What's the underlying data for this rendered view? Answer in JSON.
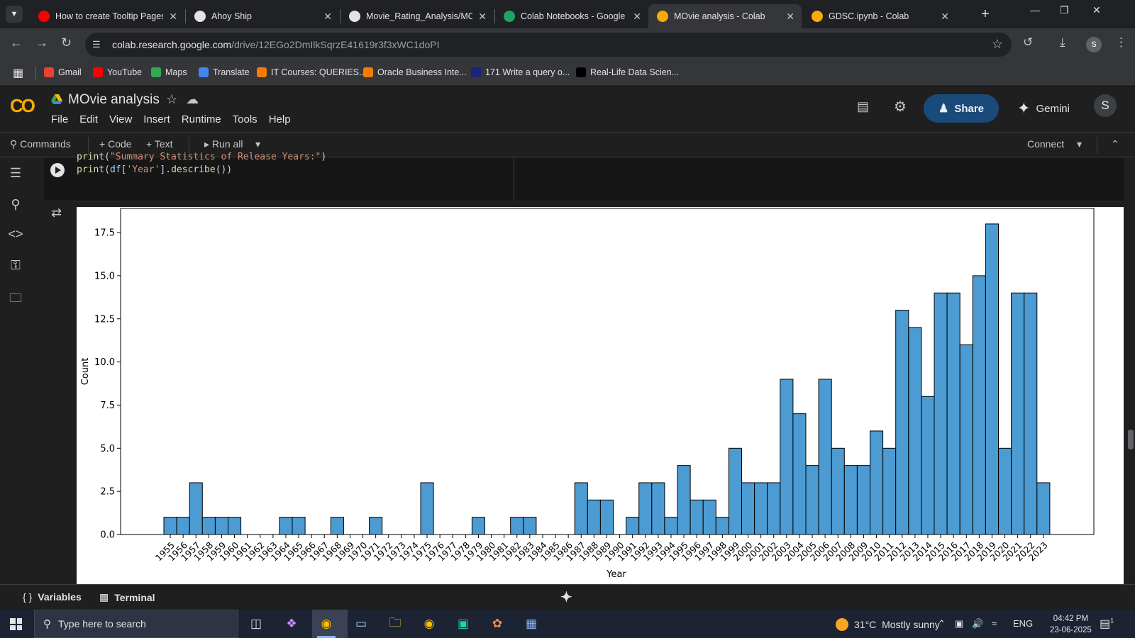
{
  "browser": {
    "tabs": [
      {
        "title": "How to create Tooltip Pages",
        "favicon": "youtube-icon",
        "color": "#ff0000"
      },
      {
        "title": "Ahoy Ship",
        "favicon": "chatgpt-icon",
        "color": "#e3e3e3"
      },
      {
        "title": "Movie_Rating_Analysis/MOvi",
        "favicon": "github-icon",
        "color": "#e3e3e3"
      },
      {
        "title": "Colab Notebooks - Google D",
        "favicon": "google-drive-icon",
        "color": "#1fa463"
      },
      {
        "title": "MOvie analysis - Colab",
        "favicon": "colab-icon",
        "color": "#f9ab00",
        "active": true
      },
      {
        "title": "GDSC.ipynb - Colab",
        "favicon": "colab-icon",
        "color": "#f9ab00"
      }
    ],
    "url_host": "colab.research.google.com",
    "url_path": "/drive/12EGo2DmIlkSqrzE41619r3f3xWC1doPI",
    "profile_initial": "S",
    "bookmarks": [
      {
        "label": "Gmail",
        "icon": "gmail-icon",
        "color": "#ea4335"
      },
      {
        "label": "YouTube",
        "icon": "youtube-icon",
        "color": "#ff0000"
      },
      {
        "label": "Maps",
        "icon": "maps-icon",
        "color": "#34a853"
      },
      {
        "label": "Translate",
        "icon": "translate-icon",
        "color": "#4285f4"
      },
      {
        "label": "IT Courses: QUERIES...",
        "icon": "blogger-icon",
        "color": "#f57c00"
      },
      {
        "label": "Oracle Business Inte...",
        "icon": "blogger-icon",
        "color": "#f57c00"
      },
      {
        "label": "171 Write a query o...",
        "icon": "star-icon",
        "color": "#1a237e"
      },
      {
        "label": "Real-Life Data Scien...",
        "icon": "medium-icon",
        "color": "#000000"
      }
    ]
  },
  "colab": {
    "notebook_title": "MOvie analysis",
    "menu": [
      "File",
      "Edit",
      "View",
      "Insert",
      "Runtime",
      "Tools",
      "Help"
    ],
    "share_label": "Share",
    "gemini_label": "Gemini",
    "avatar_initial": "S",
    "commands_label": "Commands",
    "code_label": "Code",
    "text_label": "Text",
    "run_all_label": "Run all",
    "connect_label": "Connect",
    "code_lines": [
      "print(\"Summary Statistics of Release Years:\")",
      "print(df['Year'].describe())"
    ],
    "bottom": {
      "variables_label": "Variables",
      "terminal_label": "Terminal"
    }
  },
  "chart_data": {
    "type": "bar",
    "xlabel": "Year",
    "ylabel": "Count",
    "ylim": [
      0,
      18.9
    ],
    "yticks": [
      "0.0",
      "2.5",
      "5.0",
      "7.5",
      "10.0",
      "12.5",
      "15.0",
      "17.5"
    ],
    "bar_color": "#4c9bd2",
    "tick_labels": [
      "1955",
      "1956",
      "1957",
      "1958",
      "1959",
      "1960",
      "1961",
      "1962",
      "1963",
      "1964",
      "1965",
      "1966",
      "1967",
      "1968",
      "1969",
      "1970",
      "1971",
      "1972",
      "1973",
      "1974",
      "1975",
      "1976",
      "1977",
      "1978",
      "1979",
      "1980",
      "1981",
      "1982",
      "1983",
      "1984",
      "1985",
      "1986",
      "1987",
      "1988",
      "1989",
      "1990",
      "1991",
      "1992",
      "1993",
      "1994",
      "1995",
      "1996",
      "1997",
      "1998",
      "1999",
      "2000",
      "2001",
      "2002",
      "2003",
      "2004",
      "2005",
      "2006",
      "2007",
      "2008",
      "2009",
      "2010",
      "2011",
      "2012",
      "2013",
      "2014",
      "2015",
      "2016",
      "2017",
      "2018",
      "2019",
      "2020",
      "2021",
      "2022",
      "2023"
    ],
    "bins": [
      1,
      1,
      3,
      1,
      1,
      1,
      0,
      0,
      0,
      1,
      1,
      0,
      0,
      1,
      0,
      0,
      1,
      0,
      0,
      0,
      3,
      0,
      0,
      0,
      1,
      0,
      0,
      1,
      1,
      0,
      0,
      0,
      3,
      2,
      2,
      0,
      1,
      3,
      3,
      1,
      4,
      2,
      2,
      1,
      5,
      3,
      3,
      3,
      9,
      7,
      4,
      9,
      5,
      4,
      4,
      6,
      5,
      13,
      12,
      8,
      14,
      14,
      11,
      15,
      18,
      5,
      14,
      14,
      3
    ]
  },
  "taskbar": {
    "search_placeholder": "Type here to search",
    "temperature": "31°C",
    "weather": "Mostly sunny",
    "language": "ENG",
    "time": "04:42 PM",
    "date": "23-06-2025",
    "notification_count": "1"
  }
}
